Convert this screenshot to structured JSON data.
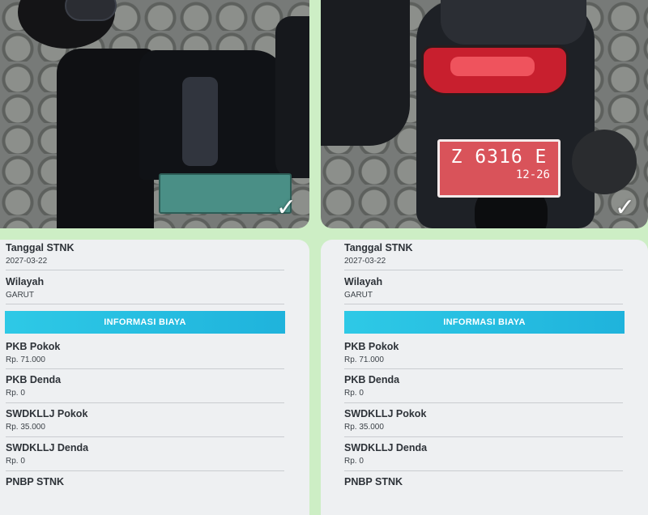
{
  "colors": {
    "page_background": "#cdeec5",
    "card_background": "#eef0f2",
    "section_header": "#2ec9e6",
    "plate_left": "#4a8f86",
    "plate_right": "#d9535a"
  },
  "icons": {
    "check": "✓"
  },
  "panels": [
    {
      "photo": {
        "subject": "motorcycle front view"
      },
      "fields_top": [
        {
          "label": "Tanggal STNK",
          "value": "2027-03-22"
        },
        {
          "label": "Wilayah",
          "value": "GARUT"
        }
      ],
      "section_title": "INFORMASI BIAYA",
      "fields_bottom": [
        {
          "label": "PKB Pokok",
          "value": "Rp. 71.000"
        },
        {
          "label": "PKB Denda",
          "value": "Rp. 0"
        },
        {
          "label": "SWDKLLJ Pokok",
          "value": "Rp. 35.000"
        },
        {
          "label": "SWDKLLJ Denda",
          "value": "Rp. 0"
        },
        {
          "label": "PNBP STNK",
          "value": ""
        }
      ]
    },
    {
      "photo": {
        "subject": "motorcycle rear view",
        "plate_number": "Z 6316 E",
        "plate_expiry": "12-26"
      },
      "fields_top": [
        {
          "label": "Tanggal STNK",
          "value": "2027-03-22"
        },
        {
          "label": "Wilayah",
          "value": "GARUT"
        }
      ],
      "section_title": "INFORMASI BIAYA",
      "fields_bottom": [
        {
          "label": "PKB Pokok",
          "value": "Rp. 71.000"
        },
        {
          "label": "PKB Denda",
          "value": "Rp. 0"
        },
        {
          "label": "SWDKLLJ Pokok",
          "value": "Rp. 35.000"
        },
        {
          "label": "SWDKLLJ Denda",
          "value": "Rp. 0"
        },
        {
          "label": "PNBP STNK",
          "value": ""
        }
      ]
    }
  ]
}
